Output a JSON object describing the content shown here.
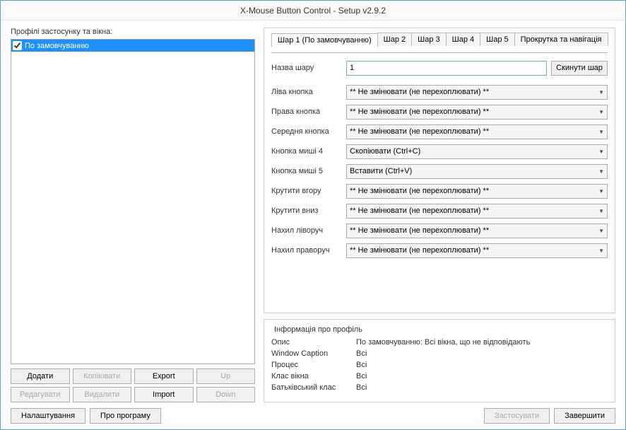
{
  "window": {
    "title": "X-Mouse Button Control - Setup v2.9.2"
  },
  "leftPanel": {
    "label": "Профілі застосунку та вікна:",
    "profile": "По замовчуванню",
    "buttons": {
      "add": "Додати",
      "copy": "Копіювати",
      "export": "Export",
      "up": "Up",
      "edit": "Редагувати",
      "delete": "Видалити",
      "import": "Import",
      "down": "Down"
    }
  },
  "tabs": {
    "t1": "Шар 1 (По замовчуванню)",
    "t2": "Шар 2",
    "t3": "Шар 3",
    "t4": "Шар 4",
    "t5": "Шар 5",
    "scroll": "Прокрутка та навігація"
  },
  "layer": {
    "nameLabel": "Назва шару",
    "nameValue": "1",
    "reset": "Скинути шар",
    "rows": [
      {
        "label": "Ліва кнопка",
        "value": "** Не змінювати (не перехоплювати) **"
      },
      {
        "label": "Права кнопка",
        "value": "** Не змінювати (не перехоплювати) **"
      },
      {
        "label": "Середня кнопка",
        "value": "** Не змінювати (не перехоплювати) **"
      },
      {
        "label": "Кнопка миші 4",
        "value": "Скопіювати (Ctrl+C)"
      },
      {
        "label": "Кнопка миші 5",
        "value": "Вставити (Ctrl+V)"
      },
      {
        "label": "Крутити вгору",
        "value": "** Не змінювати (не перехоплювати) **"
      },
      {
        "label": "Крутити вниз",
        "value": "** Не змінювати (не перехоплювати) **"
      },
      {
        "label": "Нахил ліворуч",
        "value": "** Не змінювати (не перехоплювати) **"
      },
      {
        "label": "Нахил праворуч",
        "value": "** Не змінювати (не перехоплювати) **"
      }
    ]
  },
  "info": {
    "title": "Інформація про профіль",
    "descLabel": "Опис",
    "descValue": "По замовчуванню: Всі вікна, що не відповідають",
    "captionLabel": "Window Caption",
    "captionValue": "Всі",
    "processLabel": "Процес",
    "processValue": "Всі",
    "classLabel": "Клас вікна",
    "classValue": "Всі",
    "parentLabel": "Батьківський клас",
    "parentValue": "Всі"
  },
  "bottom": {
    "settings": "Налаштування",
    "about": "Про програму",
    "apply": "Застосувати",
    "close": "Завершити"
  }
}
